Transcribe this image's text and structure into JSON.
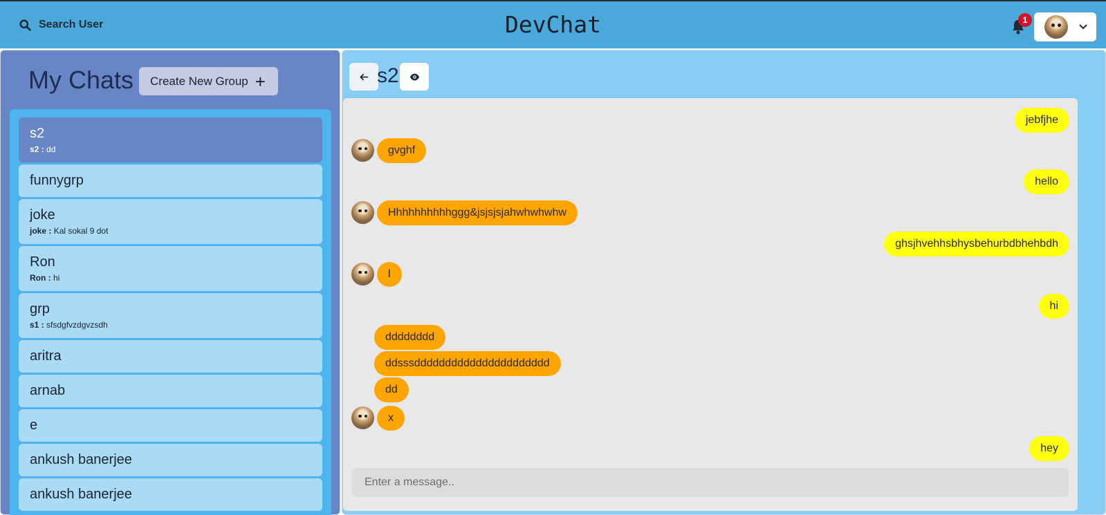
{
  "header": {
    "search_label": "Search User",
    "title": "DevChat",
    "notification_count": "1"
  },
  "sidebar": {
    "title": "My Chats",
    "create_group_label": "Create New Group",
    "create_group_icon": "+",
    "chats": [
      {
        "name": "s2",
        "preview_sender": "s2 :",
        "preview_text": "dd",
        "active": true
      },
      {
        "name": "funnygrp"
      },
      {
        "name": "joke",
        "preview_sender": "joke :",
        "preview_text": "Kal sokal 9 dot"
      },
      {
        "name": "Ron",
        "preview_sender": "Ron :",
        "preview_text": "hi"
      },
      {
        "name": "grp",
        "preview_sender": "s1 :",
        "preview_text": "sfsdgfvzdgvzsdh"
      },
      {
        "name": "aritra"
      },
      {
        "name": "arnab"
      },
      {
        "name": "e"
      },
      {
        "name": "ankush banerjee"
      },
      {
        "name": "ankush banerjee"
      }
    ]
  },
  "chat": {
    "title": "s2",
    "back_icon": "arrow-left-icon",
    "view_icon": "eye-icon",
    "messages": [
      {
        "text": "jebfjhe",
        "own": true
      },
      {
        "text": "gvghf",
        "own": false,
        "avatar": true
      },
      {
        "text": "hello",
        "own": true
      },
      {
        "text": "Hhhhhhhhhhggg&jsjsjsjahwhwhwhw",
        "own": false,
        "avatar": true
      },
      {
        "text": "ghsjhvehhsbhysbehurbdbhehbdh",
        "own": true
      },
      {
        "text": "l",
        "own": false,
        "avatar": true
      },
      {
        "text": "hi",
        "own": true
      },
      {
        "text": "dddddddd",
        "own": false,
        "avatar": false
      },
      {
        "text": "ddsssdddddddddddddddddddddd",
        "own": false,
        "avatar": false
      },
      {
        "text": "dd",
        "own": false,
        "avatar": false
      },
      {
        "text": "x",
        "own": false,
        "avatar": true
      },
      {
        "text": "hey",
        "own": true
      }
    ],
    "input_placeholder": "Enter a message.."
  },
  "colors": {
    "header_bg": "#4aa8db",
    "sidebar_bg": "#6885c6",
    "chat_list_bg": "#4db4ee",
    "chat_item_bg": "#a9dbf7",
    "chat_panel_bg": "#87cdf4",
    "messages_bg": "#e8e8e8",
    "own_bubble": "#ffff0f",
    "other_bubble": "#ffa500",
    "badge": "#d0142a"
  }
}
